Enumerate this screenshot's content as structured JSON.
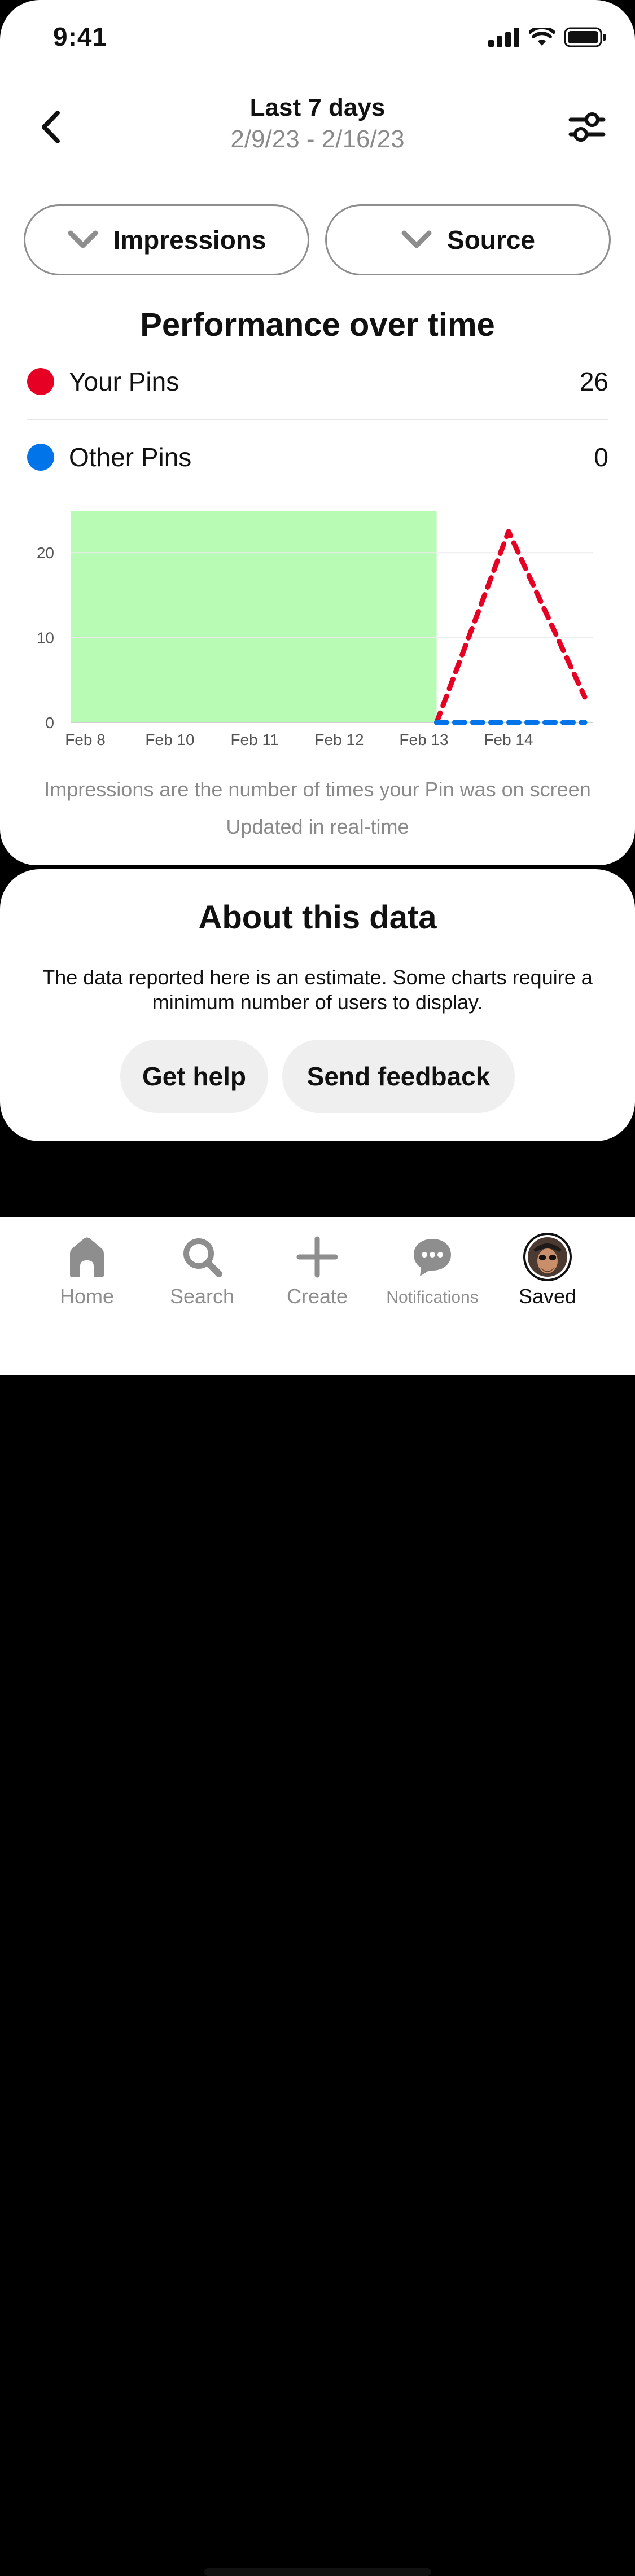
{
  "status_bar": {
    "time": "9:41"
  },
  "header": {
    "title": "Last 7 days",
    "date_range": "2/9/23 - 2/16/23",
    "back_icon": "chevron-left-icon",
    "filter_icon": "sliders-icon"
  },
  "filters": {
    "metric_label": "Impressions",
    "source_label": "Source"
  },
  "performance": {
    "title": "Performance over time",
    "legend": [
      {
        "label": "Your Pins",
        "value": "26",
        "color": "#e60023"
      },
      {
        "label": "Other Pins",
        "value": "0",
        "color": "#0074e8"
      }
    ]
  },
  "chart_data": {
    "type": "line",
    "categories": [
      "Feb 8",
      "Feb 10",
      "Feb 11",
      "Feb 12",
      "Feb 13",
      "Feb 14"
    ],
    "ylim": [
      0,
      25
    ],
    "yticks": [
      "0",
      "10",
      "20"
    ],
    "grid": true,
    "highlight_region": {
      "from_index": 0,
      "to_index": 4.15,
      "color": "#b8fbb5"
    },
    "series": [
      {
        "name": "Your Pins",
        "color": "#e60023",
        "style": "dashed",
        "x": [
          4.15,
          5.0,
          5.9
        ],
        "values": [
          0,
          22.5,
          3
        ]
      },
      {
        "name": "Other Pins",
        "color": "#0074e8",
        "style": "dashed",
        "x": [
          4.15,
          5.9
        ],
        "values": [
          0,
          0
        ]
      }
    ]
  },
  "notes": {
    "impressions_note": "Impressions are the number of times your Pin was on screen",
    "updated_note": "Updated in real-time"
  },
  "about": {
    "title": "About this data",
    "body": "The data reported here is an estimate. Some charts require a minimum number of users to display.",
    "help_button": "Get help",
    "feedback_button": "Send feedback"
  },
  "tabbar": {
    "home": "Home",
    "search": "Search",
    "create": "Create",
    "notifications": "Notifications",
    "saved": "Saved"
  }
}
